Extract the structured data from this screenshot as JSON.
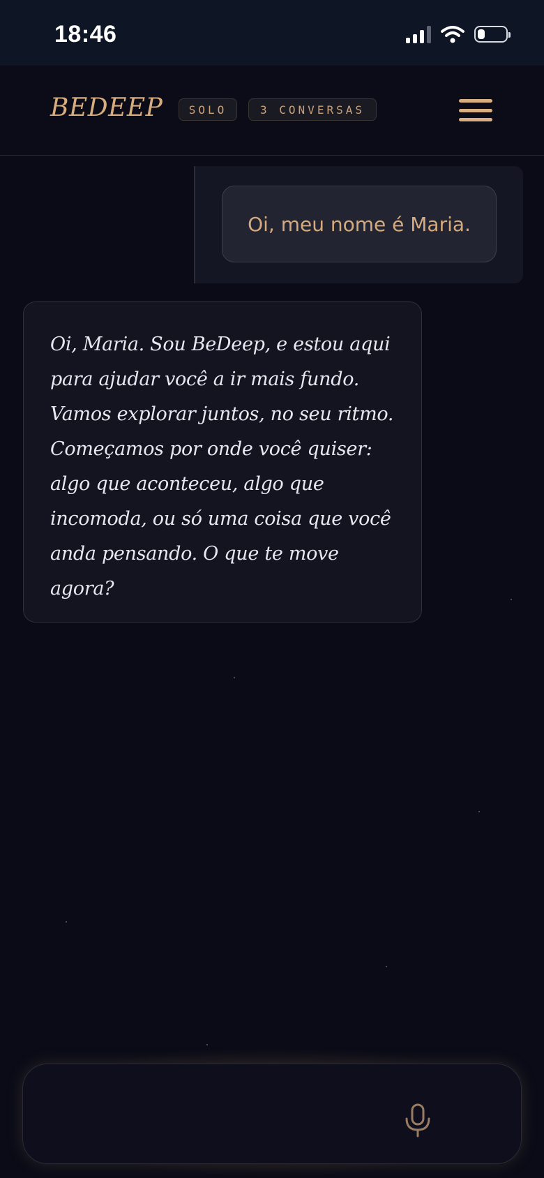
{
  "status_bar": {
    "time": "18:46"
  },
  "header": {
    "brand": "BEDEEP",
    "mode_chip": "SOLO",
    "conversations_chip": "3 CONVERSAS",
    "menu_icon": "hamburger-menu-icon"
  },
  "messages": {
    "user": "Oi, meu nome é Maria.",
    "assistant": "Oi, Maria. Sou BeDeep, e estou aqui para ajudar você a ir mais fundo. Vamos explorar juntos, no seu ritmo. Começamos por onde você quiser: algo que aconteceu, algo que incomoda, ou só uma coisa que você anda pensando. O que te move agora?"
  },
  "input": {
    "mic_icon": "microphone-icon"
  },
  "colors": {
    "accent": "#d8ad7e",
    "background": "#0a0b17",
    "text": "#e8e6ee"
  }
}
